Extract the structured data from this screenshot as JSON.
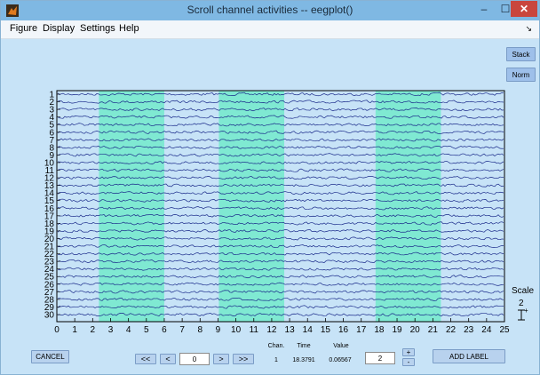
{
  "window": {
    "title": "Scroll channel activities -- eegplot()",
    "minimize_glyph": "–",
    "maximize_glyph": "☐",
    "close_glyph": "✕"
  },
  "menu": [
    "Figure",
    "Display",
    "Settings",
    "Help"
  ],
  "menu_dock_glyph": "↘",
  "buttons": {
    "stack": "Stack",
    "norm": "Norm",
    "cancel": "CANCEL",
    "first": "<<",
    "prev": "<",
    "next": ">",
    "last": ">>",
    "plus": "+",
    "minus": "-",
    "add_label": "ADD LABEL"
  },
  "time_position": "0",
  "readout": {
    "chan_label": "Chan.",
    "time_label": "Time",
    "value_label": "Value",
    "chan": "1",
    "time": "18.3791",
    "value": "0.06567"
  },
  "spacing": "2",
  "scale": {
    "label": "Scale",
    "value": "2",
    "plus_glyph": "+"
  },
  "chart_data": {
    "type": "line",
    "xlim": [
      0,
      25
    ],
    "x_ticks": [
      "0",
      "1",
      "2",
      "3",
      "4",
      "5",
      "6",
      "7",
      "8",
      "9",
      "10",
      "11",
      "12",
      "13",
      "14",
      "15",
      "16",
      "17",
      "18",
      "19",
      "20",
      "21",
      "22",
      "23",
      "24",
      "25"
    ],
    "channels": [
      "1",
      "2",
      "3",
      "4",
      "5",
      "6",
      "7",
      "8",
      "9",
      "10",
      "11",
      "12",
      "13",
      "14",
      "15",
      "16",
      "17",
      "18",
      "19",
      "20",
      "21",
      "22",
      "23",
      "24",
      "25",
      "26",
      "27",
      "28",
      "29",
      "30"
    ],
    "highlight_regions": [
      [
        2.35,
        6.0
      ],
      [
        9.05,
        12.7
      ],
      [
        17.8,
        21.45
      ]
    ],
    "highlight_color": "#7fe9d2",
    "trace_color": "#1a2a8a",
    "grid": false
  }
}
